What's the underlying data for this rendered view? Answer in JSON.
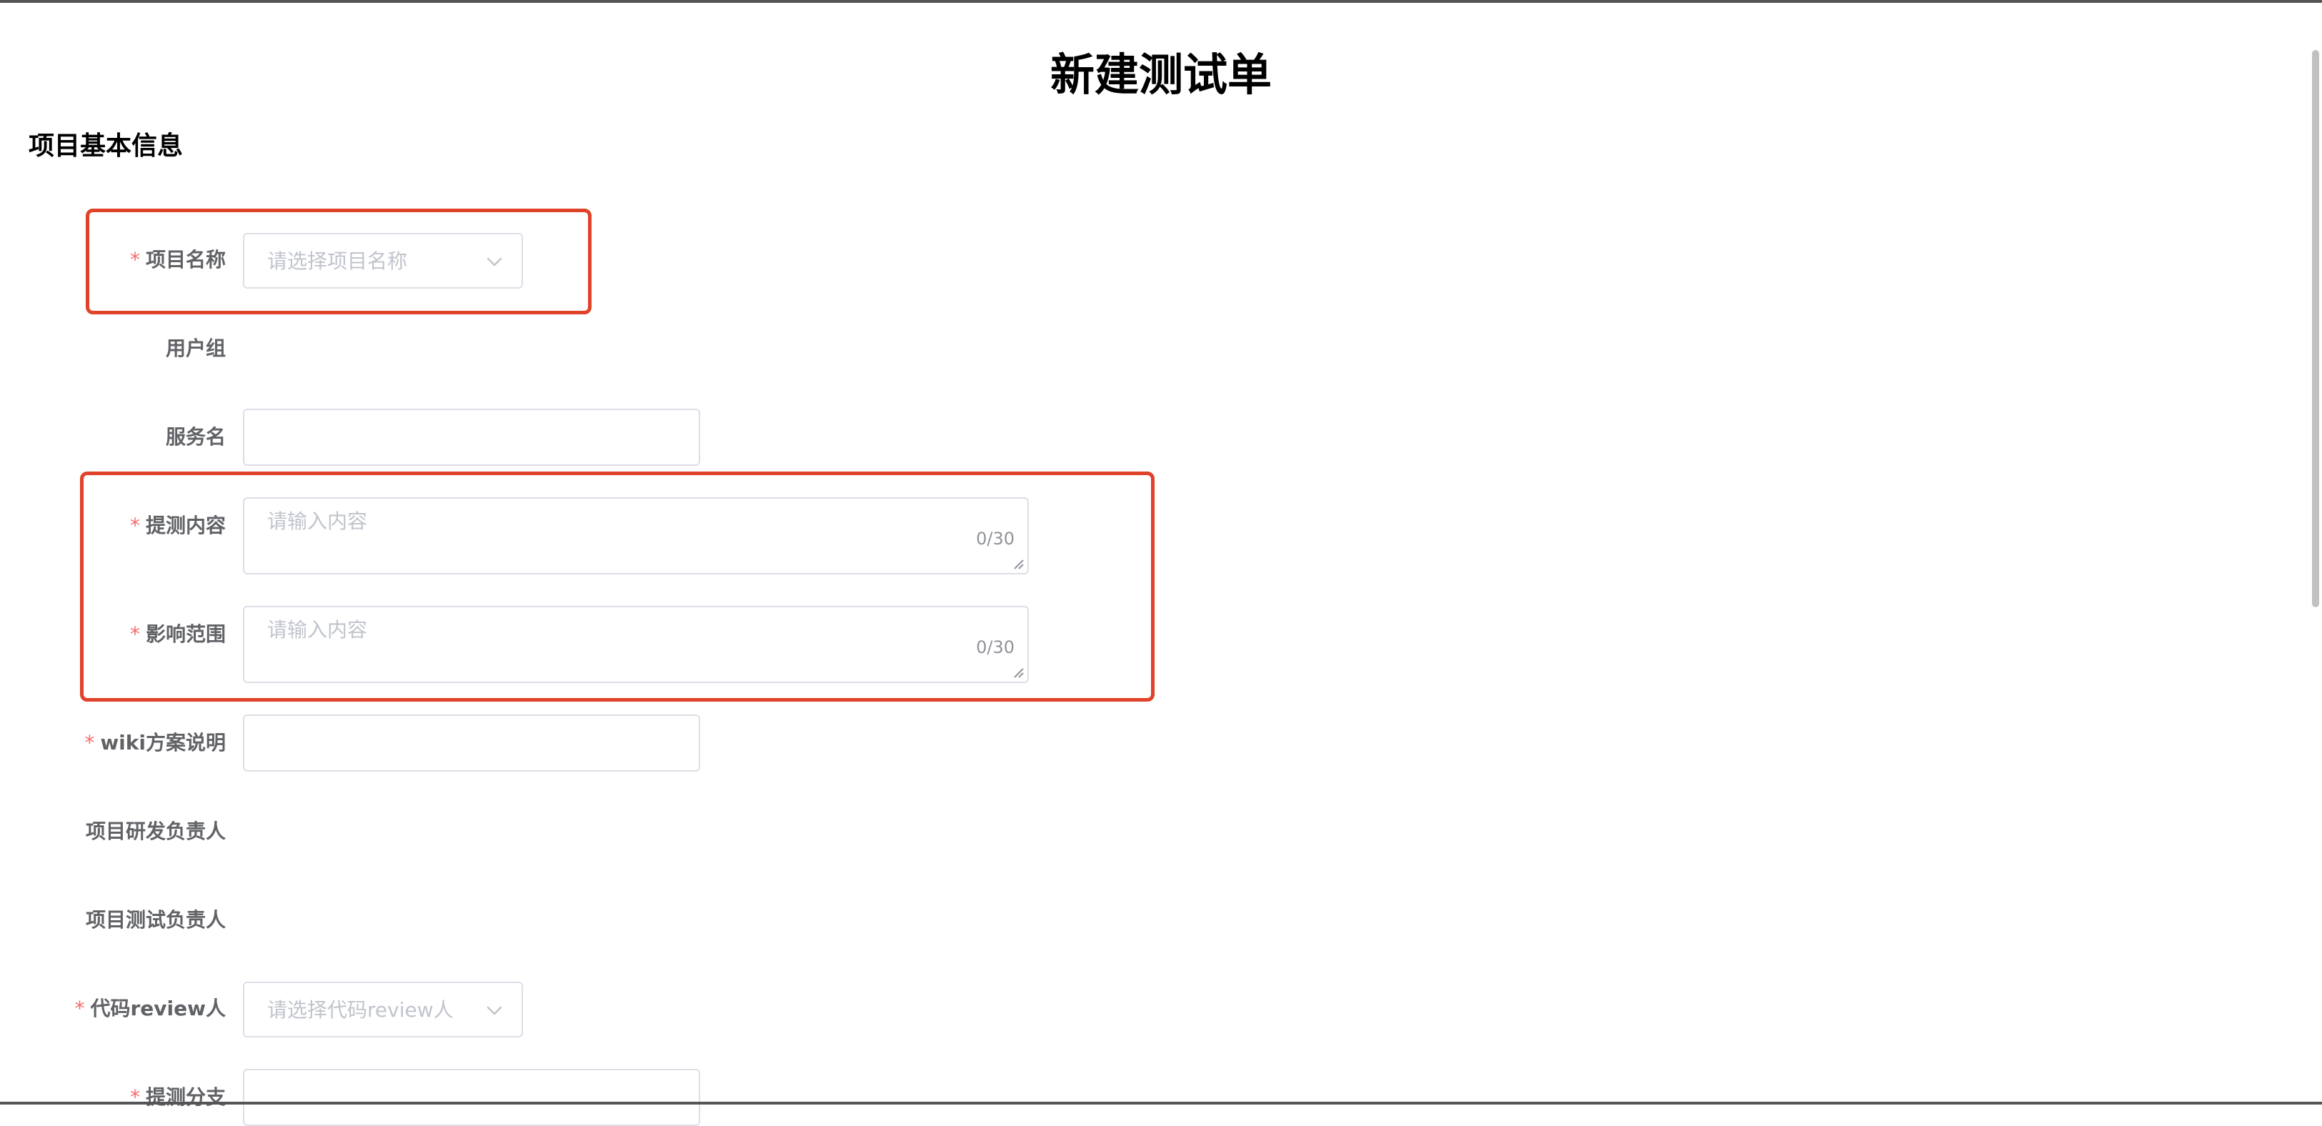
{
  "page": {
    "title": "新建测试单",
    "section_title": "项目基本信息"
  },
  "form": {
    "project_name": {
      "label": "项目名称",
      "required": "*",
      "placeholder": "请选择项目名称"
    },
    "user_group": {
      "label": "用户组"
    },
    "service_name": {
      "label": "服务名"
    },
    "test_content": {
      "label": "提测内容",
      "required": "*",
      "placeholder": "请输入内容",
      "count": "0/30"
    },
    "impact_scope": {
      "label": "影响范围",
      "required": "*",
      "placeholder": "请输入内容",
      "count": "0/30"
    },
    "wiki": {
      "label": "wiki方案说明",
      "required": "*"
    },
    "dev_owner": {
      "label": "项目研发负责人"
    },
    "test_owner": {
      "label": "项目测试负责人"
    },
    "code_reviewer": {
      "label": "代码review人",
      "required": "*",
      "placeholder": "请选择代码review人"
    },
    "test_branch": {
      "label": "提测分支",
      "required": "*"
    }
  },
  "colors": {
    "highlight": "#e0422a",
    "required": "#f56c6c",
    "placeholder": "#c0c4cc",
    "border": "#dcdfe6"
  },
  "icons": {
    "select_arrow": "chevron-down-icon",
    "resize": "resize-grip-icon"
  }
}
